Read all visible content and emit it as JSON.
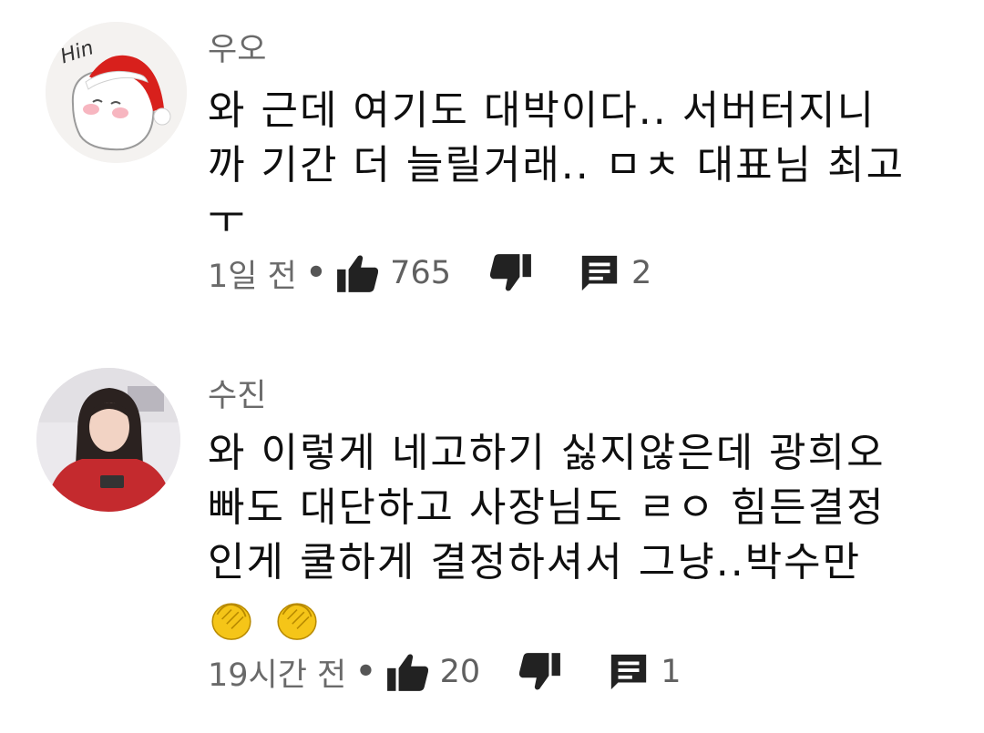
{
  "comments": [
    {
      "author": "우오",
      "avatar_icon": "santa-hat-character-avatar",
      "avatar_text": "Hin",
      "lines": [
        "와 근데 여기도 대박이다.. 서버터지니",
        "까 기간 더 늘릴거래.. ㅁㅊ 대표님 최고",
        "ㅜ"
      ],
      "time": "1일 전",
      "dot": "•",
      "likes": "765",
      "replies": "2"
    },
    {
      "author": "수진",
      "avatar_icon": "photo-avatar-red-sweater",
      "lines": [
        "와 이렇게 네고하기 싫지않은데 광희오",
        "빠도 대단하고 사장님도 ㄹㅇ 힘든결정",
        "인게 쿨하게 결정하셔서 그냥..박수만"
      ],
      "emoji_icon": "clapping-hands-emoji",
      "emoji_count": 2,
      "time": "19시간 전",
      "dot": "•",
      "likes": "20",
      "replies": "1"
    }
  ],
  "colors": {
    "text": "#0f0f0f",
    "meta": "#606060",
    "emoji": "#f5c518"
  }
}
